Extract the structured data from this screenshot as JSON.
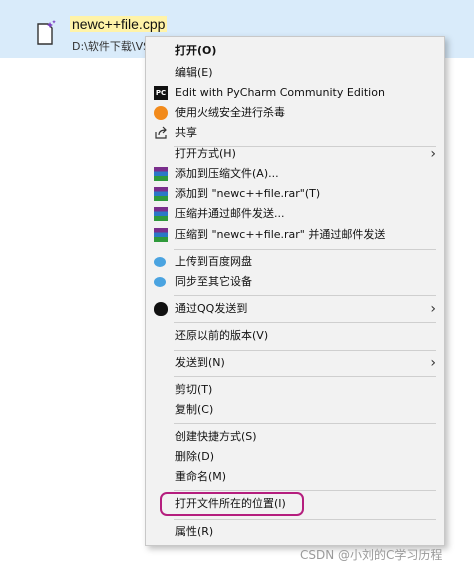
{
  "file": {
    "name": "newc++file.cpp",
    "path": "D:\\软件下载\\VS"
  },
  "menu": {
    "items": [
      {
        "label": "打开(O)"
      },
      {
        "label": "编辑(E)"
      },
      {
        "label": "Edit with PyCharm Community Edition",
        "icon_text": "PC"
      },
      {
        "label": "使用火绒安全进行杀毒"
      },
      {
        "label": "共享"
      },
      {
        "label": "打开方式(H)"
      },
      {
        "label": "添加到压缩文件(A)..."
      },
      {
        "label": "添加到 \"newc++file.rar\"(T)"
      },
      {
        "label": "压缩并通过邮件发送..."
      },
      {
        "label": "压缩到 \"newc++file.rar\" 并通过邮件发送"
      },
      {
        "label": "上传到百度网盘"
      },
      {
        "label": "同步至其它设备"
      },
      {
        "label": "通过QQ发送到"
      },
      {
        "label": "还原以前的版本(V)"
      },
      {
        "label": "发送到(N)"
      },
      {
        "label": "剪切(T)"
      },
      {
        "label": "复制(C)"
      },
      {
        "label": "创建快捷方式(S)"
      },
      {
        "label": "删除(D)"
      },
      {
        "label": "重命名(M)"
      },
      {
        "label": "打开文件所在的位置(I)"
      },
      {
        "label": "属性(R)"
      }
    ],
    "submenu_arrow": "›"
  },
  "highlight_color": "#b51e7e",
  "watermark": "CSDN @小刘的C学习历程"
}
